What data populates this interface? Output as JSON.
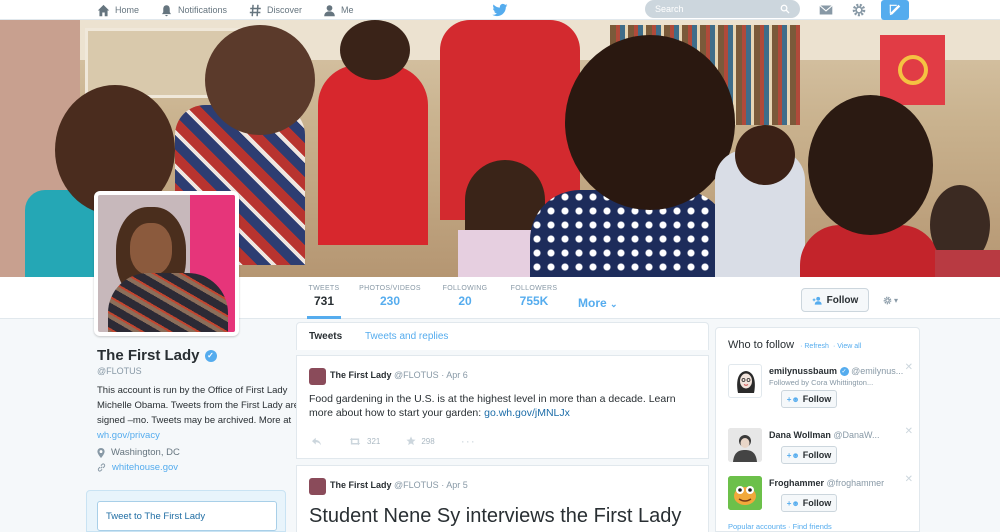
{
  "nav": {
    "home": "Home",
    "notifications": "Notifications",
    "discover": "Discover",
    "me": "Me",
    "search_placeholder": "Search"
  },
  "profile_nav": {
    "stats": [
      {
        "label": "TWEETS",
        "value": "731"
      },
      {
        "label": "PHOTOS/VIDEOS",
        "value": "230"
      },
      {
        "label": "FOLLOWING",
        "value": "20"
      },
      {
        "label": "FOLLOWERS",
        "value": "755K"
      }
    ],
    "more": "More",
    "follow": "Follow"
  },
  "profile": {
    "name": "The First Lady",
    "handle": "@FLOTUS",
    "bio": "This account is run by the Office of First Lady Michelle Obama. Tweets from the First Lady are signed –mo. Tweets may be archived. More at ",
    "bio_link": "wh.gov/privacy",
    "location": "Washington, DC",
    "url": "whitehouse.gov",
    "tweet_to": "Tweet to The First Lady"
  },
  "tabs": {
    "tweets": "Tweets",
    "tweets_replies": "Tweets and replies"
  },
  "tweets": [
    {
      "name": "The First Lady",
      "handle": "@FLOTUS",
      "date": "· Apr 6",
      "text": "Food gardening in the U.S. is at the highest level in more than a decade. Learn more about how to start your garden: ",
      "link": "go.wh.gov/jMNLJx",
      "retweets": "321",
      "favorites": "298"
    },
    {
      "name": "The First Lady",
      "handle": "@FLOTUS",
      "date": "· Apr 5",
      "text": "Student Nene Sy interviews the First Lady about empowering women & girls for the"
    }
  ],
  "who_to_follow": {
    "title": "Who to follow",
    "refresh": "· Refresh",
    "view_all": "· View all",
    "follow_label": "Follow",
    "users": [
      {
        "name": "emilynussbaum",
        "handle": "@emilynus...",
        "context": "Followed by Cora Whittington..."
      },
      {
        "name": "Dana Wollman",
        "handle": "@DanaW...",
        "context": ""
      },
      {
        "name": "Froghammer",
        "handle": "@froghammer",
        "context": ""
      }
    ],
    "footer": "Popular accounts · Find friends"
  },
  "colors": {
    "accent": "#55acee",
    "link": "#1b6ca8",
    "header_bg": "#c9b28e"
  }
}
